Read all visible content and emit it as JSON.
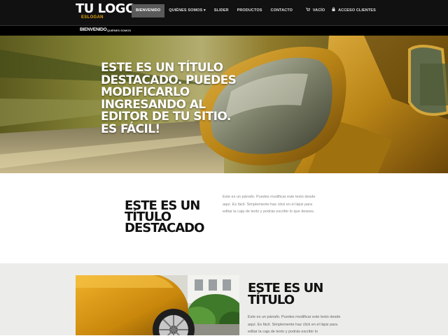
{
  "header": {
    "logo": "TU LOGO",
    "slogan": "ESLOGAN",
    "nav": [
      {
        "label": "BIENVENIDO",
        "active": true
      },
      {
        "label": "QUIÉNES SOMOS ▾",
        "active": false
      },
      {
        "label": "SLIDER",
        "active": false
      },
      {
        "label": "PRODUCTOS",
        "active": false
      },
      {
        "label": "CONTACTO",
        "active": false
      }
    ],
    "cart": {
      "icon": "cart-icon",
      "label": "VACÍO"
    },
    "account": {
      "icon": "lock-icon",
      "label": "ACCESO CLIENTES"
    }
  },
  "subnav": {
    "title": "BIENVENIDO",
    "link": "QUIÉNES SOMOS"
  },
  "hero": {
    "title": "ESTE ES UN TÍTULO DESTACADO. PUEDES MODIFICARLO INGRESANDO AL EDITOR DE TU SITIO. ES FÁCIL!"
  },
  "section2": {
    "title": "ESTE ES UN TÍTULO DESTACADO",
    "text": "Este es un párrafo. Puedes modificar este texto desde aquí. Es fácil. Simplemente haz click en el lápiz para editar la caja de texto y podrás escribir lo que desees."
  },
  "section3": {
    "title": "ESTE ES UN TÍTULO",
    "text": "Este es un párrafo. Puedes modificar este texto desde aquí. Es fácil. Simplemente haz click en el lápiz para editar la caja de texto y podrás escribir lo"
  },
  "colors": {
    "topbar": "#111111",
    "active_nav": "#5a5a5a",
    "slogan": "#e5a411",
    "section3_bg": "#ececea"
  }
}
